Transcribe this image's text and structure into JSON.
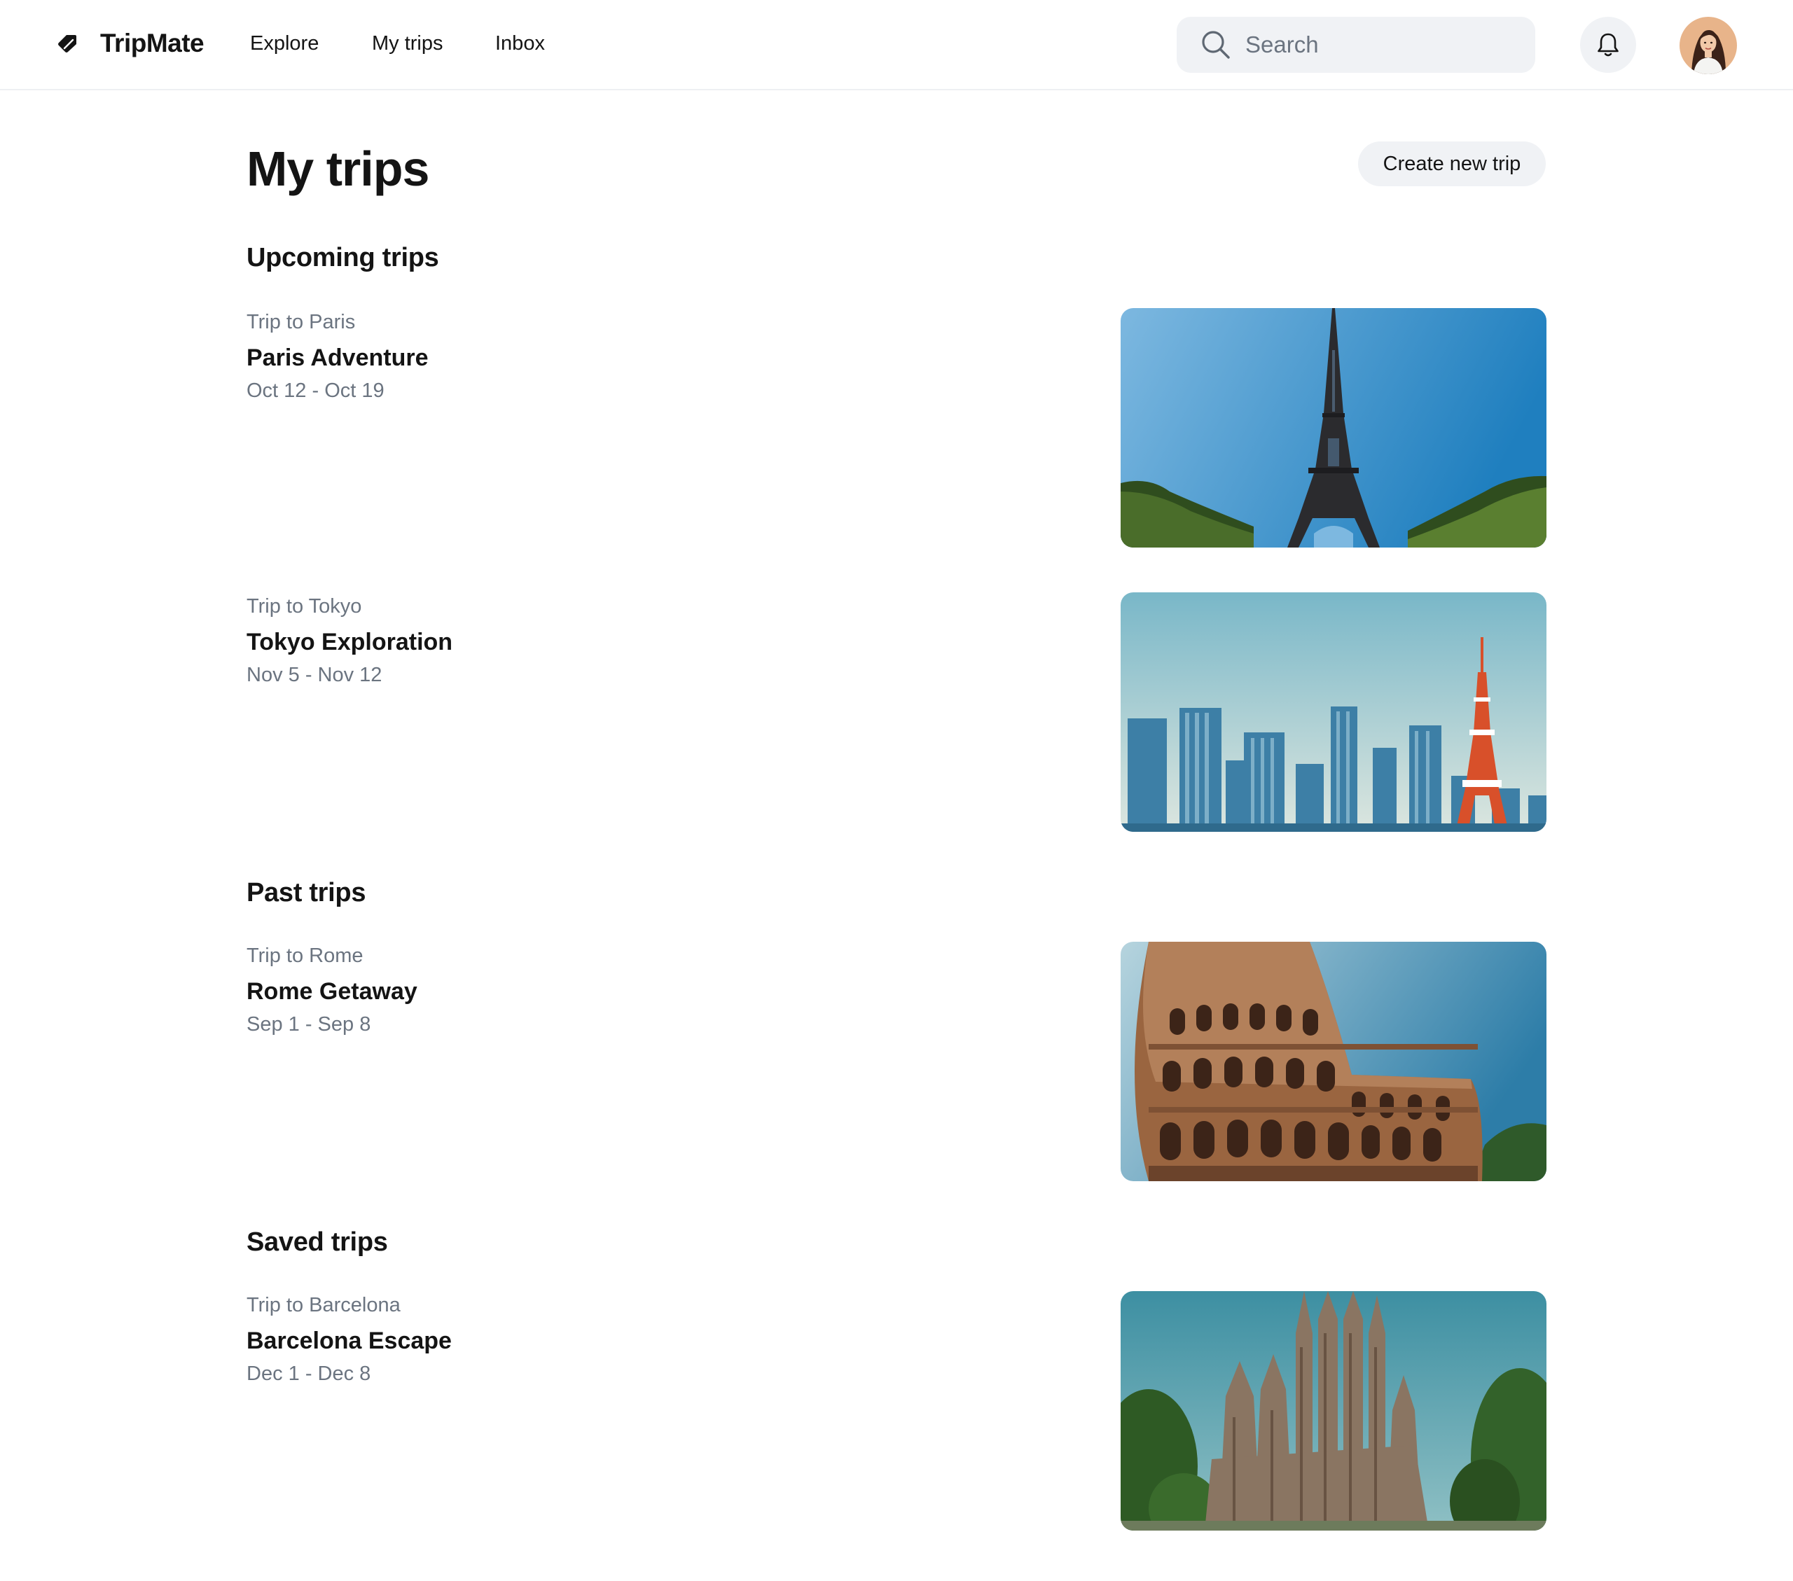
{
  "app": {
    "name": "TripMate"
  },
  "nav": {
    "links": [
      "Explore",
      "My trips",
      "Inbox"
    ]
  },
  "search": {
    "placeholder": "Search",
    "value": ""
  },
  "icons": {
    "logo": "tag-icon",
    "search": "search-icon",
    "notifications": "bell-icon",
    "avatar": "user-avatar"
  },
  "main": {
    "title": "My trips",
    "create_button": "Create new trip"
  },
  "sections": {
    "upcoming": {
      "title": "Upcoming trips",
      "trips": [
        {
          "kicker": "Trip to Paris",
          "name": "Paris Adventure",
          "dates": "Oct 12 - Oct 19",
          "image": "eiffel-tower-photo"
        },
        {
          "kicker": "Trip to Tokyo",
          "name": "Tokyo Exploration",
          "dates": "Nov 5 - Nov 12",
          "image": "tokyo-skyline-photo"
        }
      ]
    },
    "past": {
      "title": "Past trips",
      "trips": [
        {
          "kicker": "Trip to Rome",
          "name": "Rome Getaway",
          "dates": "Sep 1 - Sep 8",
          "image": "colosseum-photo"
        }
      ]
    },
    "saved": {
      "title": "Saved trips",
      "trips": [
        {
          "kicker": "Trip to Barcelona",
          "name": "Barcelona Escape",
          "dates": "Dec 1 - Dec 8",
          "image": "sagrada-familia-photo"
        }
      ]
    }
  },
  "colors": {
    "text": "#141414",
    "muted": "#6b7480",
    "chip_bg": "#f0f2f5",
    "sky": "#3f95cf"
  }
}
